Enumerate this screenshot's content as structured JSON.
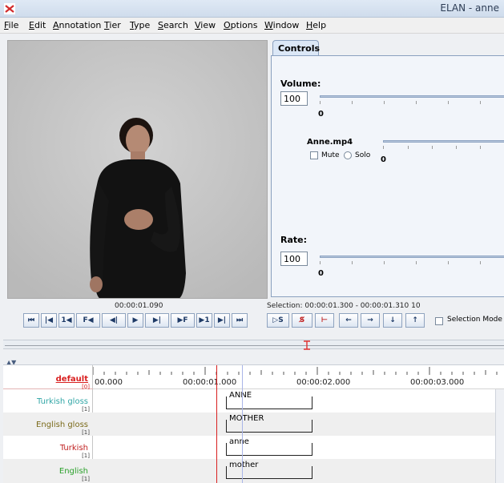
{
  "window": {
    "title": "ELAN - anne"
  },
  "menu": [
    {
      "label": "File",
      "key": "F",
      "rest": "ile"
    },
    {
      "label": "Edit",
      "key": "E",
      "rest": "dit"
    },
    {
      "label": "Annotation",
      "key": "A",
      "rest": "nnotation"
    },
    {
      "label": "Tier",
      "key": "T",
      "rest": "ier"
    },
    {
      "label": "Type",
      "key": "T",
      "rest": "ype"
    },
    {
      "label": "Search",
      "key": "S",
      "rest": "earch"
    },
    {
      "label": "View",
      "key": "V",
      "rest": "iew"
    },
    {
      "label": "Options",
      "key": "O",
      "rest": "ptions"
    },
    {
      "label": "Window",
      "key": "W",
      "rest": "indow"
    },
    {
      "label": "Help",
      "key": "H",
      "rest": "elp"
    }
  ],
  "controls": {
    "tab_label": "Controls",
    "volume_label": "Volume:",
    "volume_value": "100",
    "volume_min": "0",
    "media_label": "Anne.mp4",
    "mute_label": "Mute",
    "solo_label": "Solo",
    "media_min": "0",
    "rate_label": "Rate:",
    "rate_value": "100",
    "rate_min": "0"
  },
  "player": {
    "media_time": "00:00:01.090",
    "selection": "Selection: 00:00:01.300 - 00:00:01.310  10",
    "buttons": [
      "⏮",
      "|◀",
      "1◀",
      "F◀",
      "◀|",
      "▶",
      "▶|",
      "▶F",
      "▶1",
      "▶|",
      "⏭"
    ],
    "selection_buttons": [
      "▷S",
      "S̸",
      "⊢",
      "←",
      "→",
      "↓",
      "↑"
    ],
    "selection_mode_label": "Selection Mode"
  },
  "timeline": {
    "ruler": [
      "00.000",
      "00:00:01.000",
      "00:00:02.000",
      "00:00:03.000"
    ],
    "default_tier": "default",
    "default_count": "[0]",
    "tiers": [
      {
        "name": "Turkish gloss",
        "count": "[1]",
        "color": "#31a6a6",
        "annotation": "ANNE"
      },
      {
        "name": "English gloss",
        "count": "[1]",
        "color": "#7a6a1a",
        "annotation": "MOTHER"
      },
      {
        "name": "Turkish",
        "count": "[1]",
        "color": "#c02020",
        "annotation": "anne"
      },
      {
        "name": "English",
        "count": "[1]",
        "color": "#2aa02a",
        "annotation": "mother"
      }
    ]
  },
  "colors": {
    "accent": "#d92020",
    "panel_border": "#8aa0bf"
  }
}
